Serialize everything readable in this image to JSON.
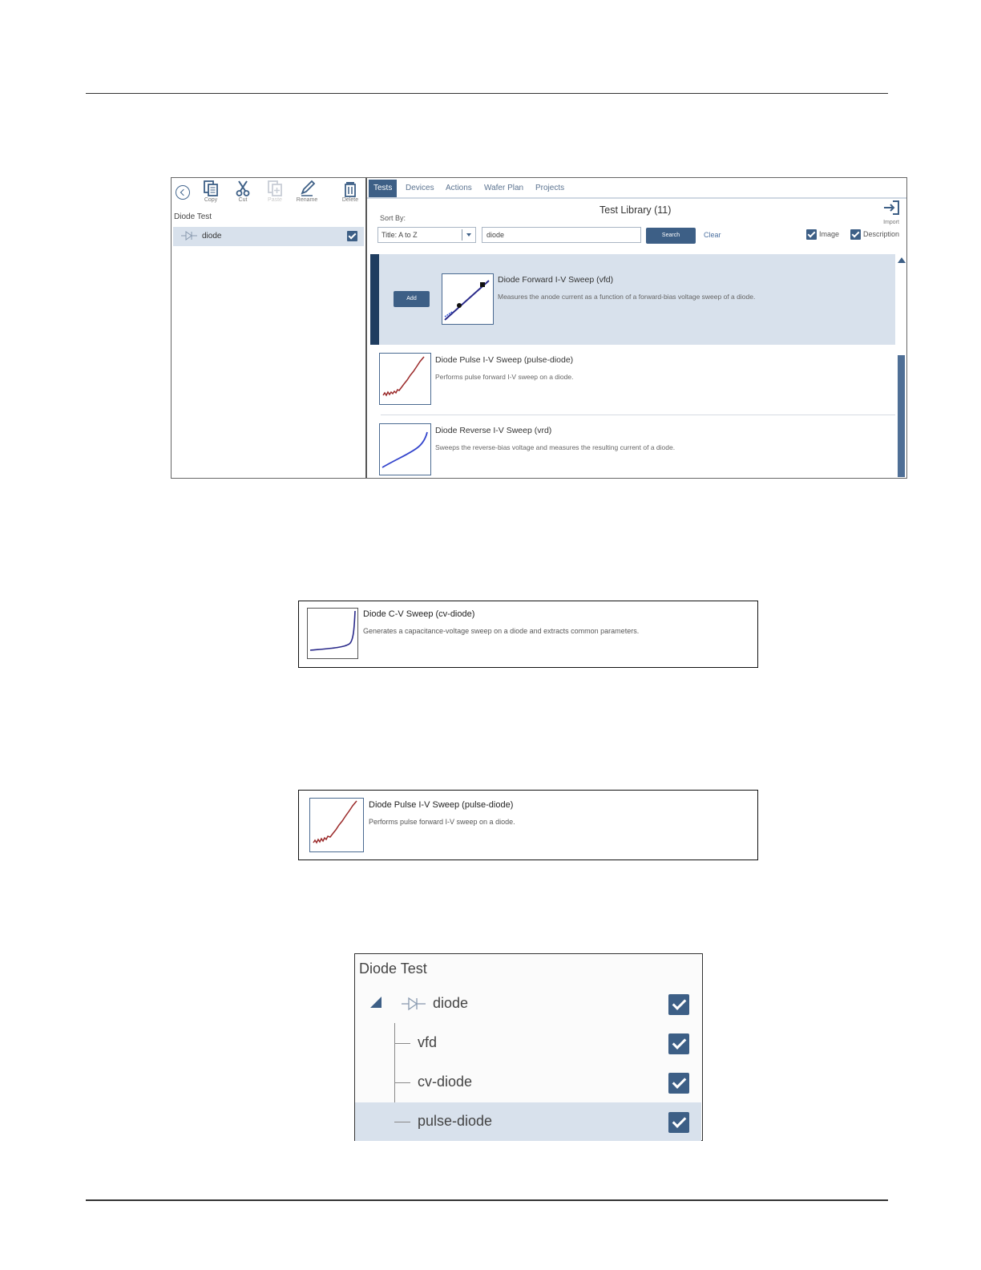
{
  "main": {
    "toolbar": {
      "copy": "Copy",
      "cut": "Cut",
      "paste": "Paste",
      "rename": "Rename",
      "delete": "Delete"
    },
    "left_pane": {
      "title": "Diode Test",
      "row_label": "diode"
    },
    "tabs": [
      "Tests",
      "Devices",
      "Actions",
      "Wafer Plan",
      "Projects"
    ],
    "library_title": "Test Library (11)",
    "import_label": "Import",
    "sort_by_label": "Sort By:",
    "sort_value": "Title: A to Z",
    "search_value": "diode",
    "search_button": "Search",
    "clear_link": "Clear",
    "image_option": "Image",
    "description_option": "Description",
    "add_button": "Add",
    "items": [
      {
        "title": "Diode Forward I-V Sweep (vfd)",
        "description": "Measures the anode current as a function of a forward-bias voltage sweep of a diode."
      },
      {
        "title": "Diode Pulse I-V Sweep (pulse-diode)",
        "description": "Performs pulse forward I-V sweep on a diode."
      },
      {
        "title": "Diode Reverse I-V Sweep (vrd)",
        "description": "Sweeps the reverse-bias voltage and measures the resulting current of a diode."
      }
    ]
  },
  "cv_callout": {
    "title": "Diode C-V Sweep (cv-diode)",
    "description": "Generates a capacitance-voltage sweep on a diode and extracts common parameters."
  },
  "pulse_callout": {
    "title": "Diode Pulse I-V Sweep (pulse-diode)",
    "description": "Performs pulse forward I-V sweep on a diode."
  },
  "tree": {
    "title": "Diode Test",
    "device": "diode",
    "children": [
      "vfd",
      "cv-diode",
      "pulse-diode"
    ]
  },
  "colors": {
    "accent": "#3d5f86",
    "selected_bg": "#d8e1ec",
    "selected_bar": "#1f3d60"
  }
}
